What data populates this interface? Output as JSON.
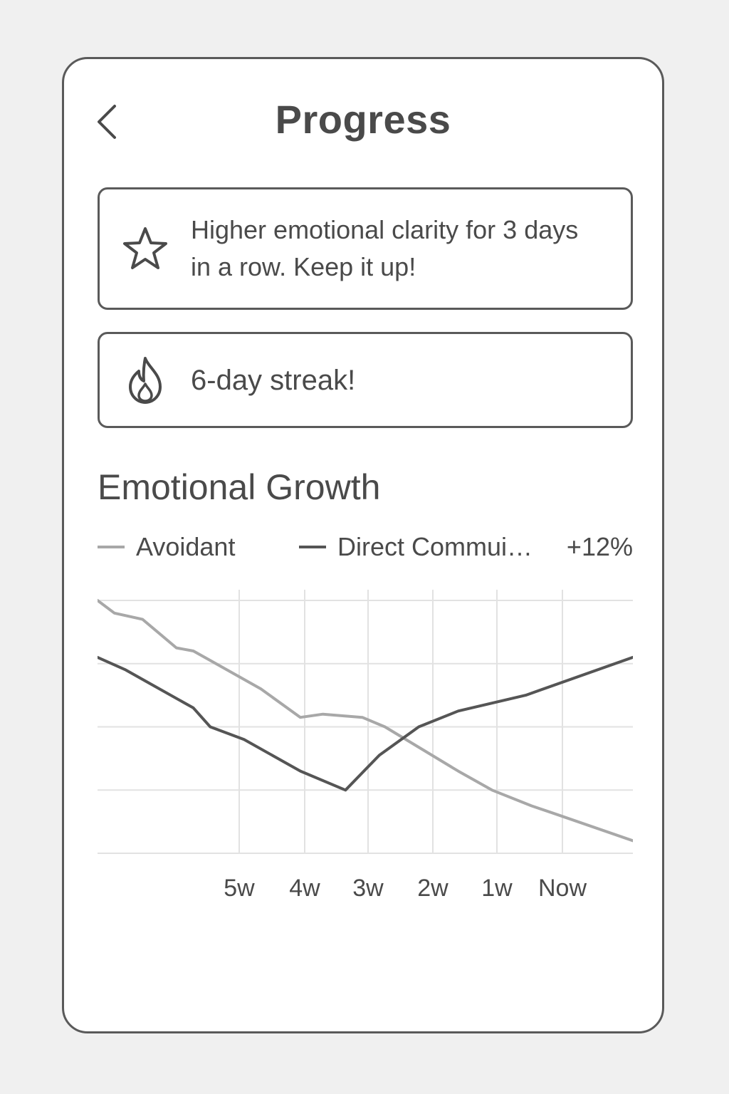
{
  "header": {
    "title": "Progress",
    "back_icon": "chevron-left-icon"
  },
  "cards": {
    "achievement": {
      "icon": "star-icon",
      "text": "Higher emotional clarity for 3 days in a row. Keep it up!"
    },
    "streak": {
      "icon": "flame-icon",
      "text": "6-day streak!"
    }
  },
  "section": {
    "title": "Emotional Growth"
  },
  "legend": {
    "avoidant": "Avoidant",
    "direct": "Direct Commui…",
    "delta": "+12%"
  },
  "colors": {
    "avoidant": "#a8a8a8",
    "direct": "#555555",
    "grid": "#e2e2e2",
    "text": "#4a4a4a"
  },
  "chart_data": {
    "type": "line",
    "categories": [
      "5w",
      "4w",
      "3w",
      "2w",
      "1w",
      "Now"
    ],
    "ylim": [
      0,
      4
    ],
    "grid": true,
    "legend_position": "top",
    "series": [
      {
        "name": "Avoidant",
        "x": [
          0.0,
          0.15,
          0.4,
          0.7,
          0.85,
          1.0,
          1.45,
          1.8,
          2.0,
          2.35,
          2.55,
          3.2,
          3.5,
          3.85,
          4.1,
          4.75
        ],
        "values": [
          4.0,
          3.8,
          3.7,
          3.25,
          3.2,
          3.05,
          2.6,
          2.15,
          2.2,
          2.15,
          2.0,
          1.3,
          1.0,
          0.75,
          0.6,
          0.2
        ]
      },
      {
        "name": "Direct Commui…",
        "x": [
          0.0,
          0.25,
          0.45,
          0.85,
          1.0,
          1.3,
          1.8,
          2.2,
          2.5,
          2.85,
          3.2,
          3.8,
          4.75
        ],
        "values": [
          3.1,
          2.9,
          2.7,
          2.3,
          2.0,
          1.8,
          1.3,
          1.0,
          1.55,
          2.0,
          2.25,
          2.5,
          3.1
        ]
      }
    ]
  }
}
